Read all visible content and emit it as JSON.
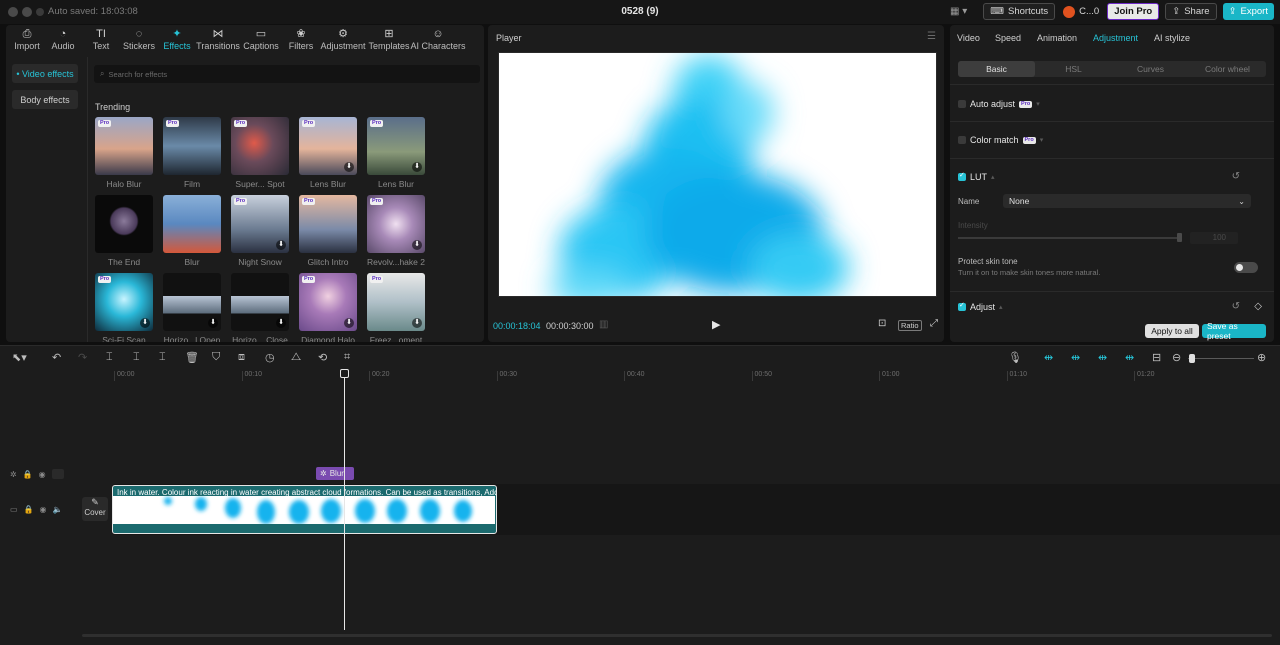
{
  "titlebar": {
    "autosave": "Auto saved: 18:03:08",
    "project_title": "0528 (9)",
    "shortcuts_label": "Shortcuts",
    "account_label": "C...0",
    "join_pro_label": "Join Pro",
    "share_label": "Share",
    "export_label": "Export"
  },
  "toolbar": [
    {
      "label": "Import",
      "icon": "import-icon"
    },
    {
      "label": "Audio",
      "icon": "audio-icon"
    },
    {
      "label": "Text",
      "icon": "text-icon"
    },
    {
      "label": "Stickers",
      "icon": "stickers-icon"
    },
    {
      "label": "Effects",
      "icon": "effects-icon",
      "active": true
    },
    {
      "label": "Transitions",
      "icon": "transitions-icon"
    },
    {
      "label": "Captions",
      "icon": "captions-icon"
    },
    {
      "label": "Filters",
      "icon": "filters-icon"
    },
    {
      "label": "Adjustment",
      "icon": "adjustment-icon"
    },
    {
      "label": "Templates",
      "icon": "templates-icon"
    },
    {
      "label": "AI Characters",
      "icon": "ai-characters-icon"
    }
  ],
  "effects_panel": {
    "side_video": "• Video effects",
    "side_body": "Body effects",
    "search_placeholder": "Search for effects",
    "section_title": "Trending",
    "items": [
      {
        "label": "Halo Blur",
        "pro": true,
        "download": false
      },
      {
        "label": "Film",
        "pro": true,
        "download": false
      },
      {
        "label": "Super... Spot",
        "pro": true,
        "download": false
      },
      {
        "label": "Lens Blur",
        "pro": true,
        "download": true
      },
      {
        "label": "Lens Blur",
        "pro": true,
        "download": true
      },
      {
        "label": "The End",
        "pro": false,
        "download": false
      },
      {
        "label": "Blur",
        "pro": false,
        "download": false
      },
      {
        "label": "Night Snow",
        "pro": true,
        "download": true
      },
      {
        "label": "Glitch Intro",
        "pro": true,
        "download": false
      },
      {
        "label": "Revolv...hake 2",
        "pro": true,
        "download": true
      },
      {
        "label": "Sci-Fi Scan",
        "pro": true,
        "download": true
      },
      {
        "label": "Horizo...l Open",
        "pro": false,
        "download": true
      },
      {
        "label": "Horizo... Close",
        "pro": false,
        "download": true
      },
      {
        "label": "Diamond Halo",
        "pro": true,
        "download": true
      },
      {
        "label": "Freez...oment",
        "pro": true,
        "download": true
      }
    ],
    "pro_badge": "Pro"
  },
  "player": {
    "title": "Player",
    "current_time": "00:00:18:04",
    "total_time": "00:00:30:00",
    "ratio_label": "Ratio"
  },
  "inspector": {
    "tabs": [
      "Video",
      "Speed",
      "Animation",
      "Adjustment",
      "AI stylize"
    ],
    "subtabs": [
      "Basic",
      "HSL",
      "Curves",
      "Color wheel"
    ],
    "auto_adjust": "Auto adjust",
    "color_match": "Color match",
    "lut": "LUT",
    "name_label": "Name",
    "name_value": "None",
    "intensity_label": "Intensity",
    "intensity_value": "100",
    "protect_skin": "Protect skin tone",
    "protect_skin_desc": "Turn it on to make skin tones more natural.",
    "adjust": "Adjust",
    "apply_all": "Apply to all",
    "save_preset": "Save as preset",
    "pro_badge": "Pro"
  },
  "timeline": {
    "ruler": [
      "00:00",
      "00:10",
      "00:20",
      "00:30",
      "00:40",
      "00:50",
      "01:00",
      "01:10",
      "01:20"
    ],
    "effect_clip_label": "Blur",
    "video_clip_caption": "Ink in water. Colour ink reacting in water creating abstract cloud formations. Can be used as transitions, Adde",
    "cover_label": "Cover"
  },
  "colors": {
    "accent": "#27c3d6",
    "export": "#1ab6c7",
    "effect_clip": "#7a4bb0"
  }
}
